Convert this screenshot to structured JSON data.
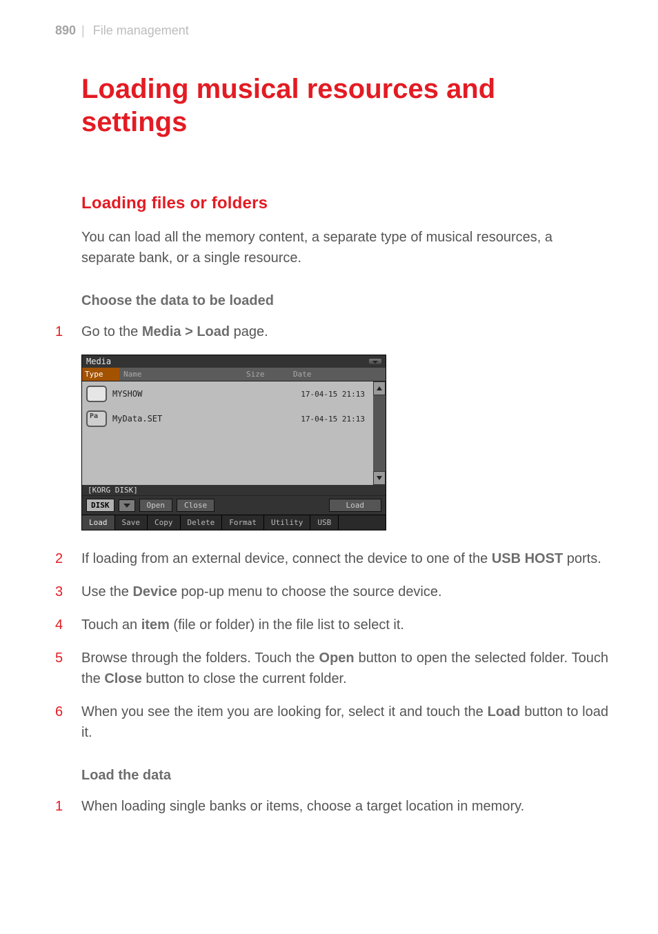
{
  "page": {
    "number": "890",
    "section": "File management"
  },
  "title": "Loading musical resources and settings",
  "subsection": "Loading files or folders",
  "intro": "You can load all the memory content, a separate type of musical resources, a separate bank, or a single resource.",
  "choose_heading": "Choose the data to be loaded",
  "steps_a": [
    {
      "n": "1",
      "before": "Go to the ",
      "kw": "Media > Load",
      "after": " page."
    },
    {
      "n": "2",
      "before": "If loading from an external device, connect the device to one of the ",
      "kw": "USB HOST",
      "after": " ports."
    },
    {
      "n": "3",
      "before": "Use the ",
      "kw": "Device",
      "after": " pop-up menu to choose the source device."
    },
    {
      "n": "4",
      "before": "Touch an ",
      "kw": "item",
      "after": " (file or folder) in the file list to select it."
    }
  ],
  "step5": {
    "n": "5",
    "t1": "Browse through the folders. Touch the ",
    "k1": "Open",
    "t2": " button to open the selected folder. Touch the ",
    "k2": "Close",
    "t3": " button to close the current folder."
  },
  "step6": {
    "n": "6",
    "t1": "When you see the item you are looking for, select it and touch the ",
    "k1": "Load",
    "t2": " button to load it."
  },
  "load_heading": "Load the data",
  "steps_b": [
    {
      "n": "1",
      "text": "When loading single banks or items, choose a target location in memory."
    }
  ],
  "ui": {
    "title": "Media",
    "cols": {
      "type": "Type",
      "name": "Name",
      "size": "Size",
      "date": "Date"
    },
    "rows": [
      {
        "name": "MYSHOW",
        "date": "17-04-15 21:13",
        "icon": "folder"
      },
      {
        "name": "MyData.SET",
        "date": "17-04-15 21:13",
        "icon": "pa"
      }
    ],
    "path": "[KORG DISK]",
    "device": "DISK",
    "buttons": {
      "open": "Open",
      "close": "Close",
      "load": "Load"
    },
    "tabs": [
      "Load",
      "Save",
      "Copy",
      "Delete",
      "Format",
      "Utility",
      "USB"
    ],
    "active_tab": 0
  }
}
